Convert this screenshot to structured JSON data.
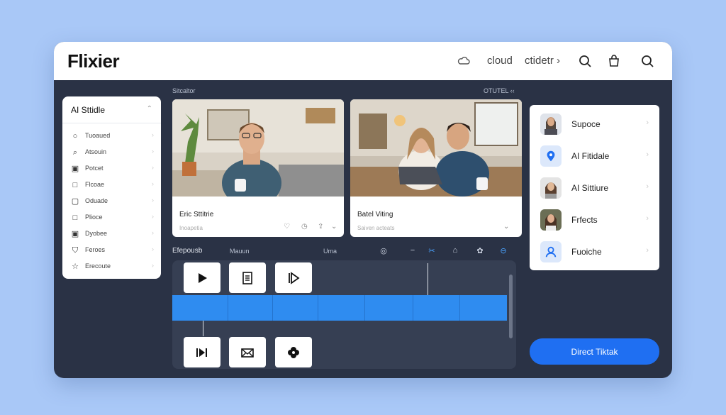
{
  "header": {
    "brand": "Flixier",
    "cloud_label": "cloud",
    "menu_label": "ctidetr ›"
  },
  "left_panel": {
    "title": "AI Sttidle",
    "items": [
      {
        "icon": "circle-icon",
        "label": "Tuoaued"
      },
      {
        "icon": "search-icon",
        "label": "Atsouin"
      },
      {
        "icon": "box-icon",
        "label": "Potcet"
      },
      {
        "icon": "square-icon",
        "label": "Flcoae"
      },
      {
        "icon": "square-icon",
        "label": "Oduade"
      },
      {
        "icon": "square-icon",
        "label": "Plioce"
      },
      {
        "icon": "square-icon",
        "label": "Dyobee"
      },
      {
        "icon": "shield-icon",
        "label": "Feroes"
      },
      {
        "icon": "star-icon",
        "label": "Erecoute"
      }
    ]
  },
  "preview": {
    "section_label": "Sitcaltor",
    "section_right": "OTUTEL ‹‹",
    "cards": [
      {
        "title": "Eric Sttitrie",
        "subtitle": "Inoapetia"
      },
      {
        "title": "Batel Viting",
        "subtitle": "Saiven acteats"
      }
    ]
  },
  "timeline": {
    "label_left": "Efepousb",
    "label_mid": "Mauun",
    "label_right": "Uma"
  },
  "right_panel": {
    "items": [
      {
        "label": "Supoce"
      },
      {
        "label": "AI Fitidale"
      },
      {
        "label": "AI Sittiure"
      },
      {
        "label": "Frfects"
      },
      {
        "label": "Fuoiche"
      }
    ]
  },
  "cta_label": "Direct Tiktak",
  "colors": {
    "page_bg": "#a9c8f7",
    "window_bg": "#2a3245",
    "accent": "#2f8cf0",
    "cta": "#1f6ff2"
  }
}
